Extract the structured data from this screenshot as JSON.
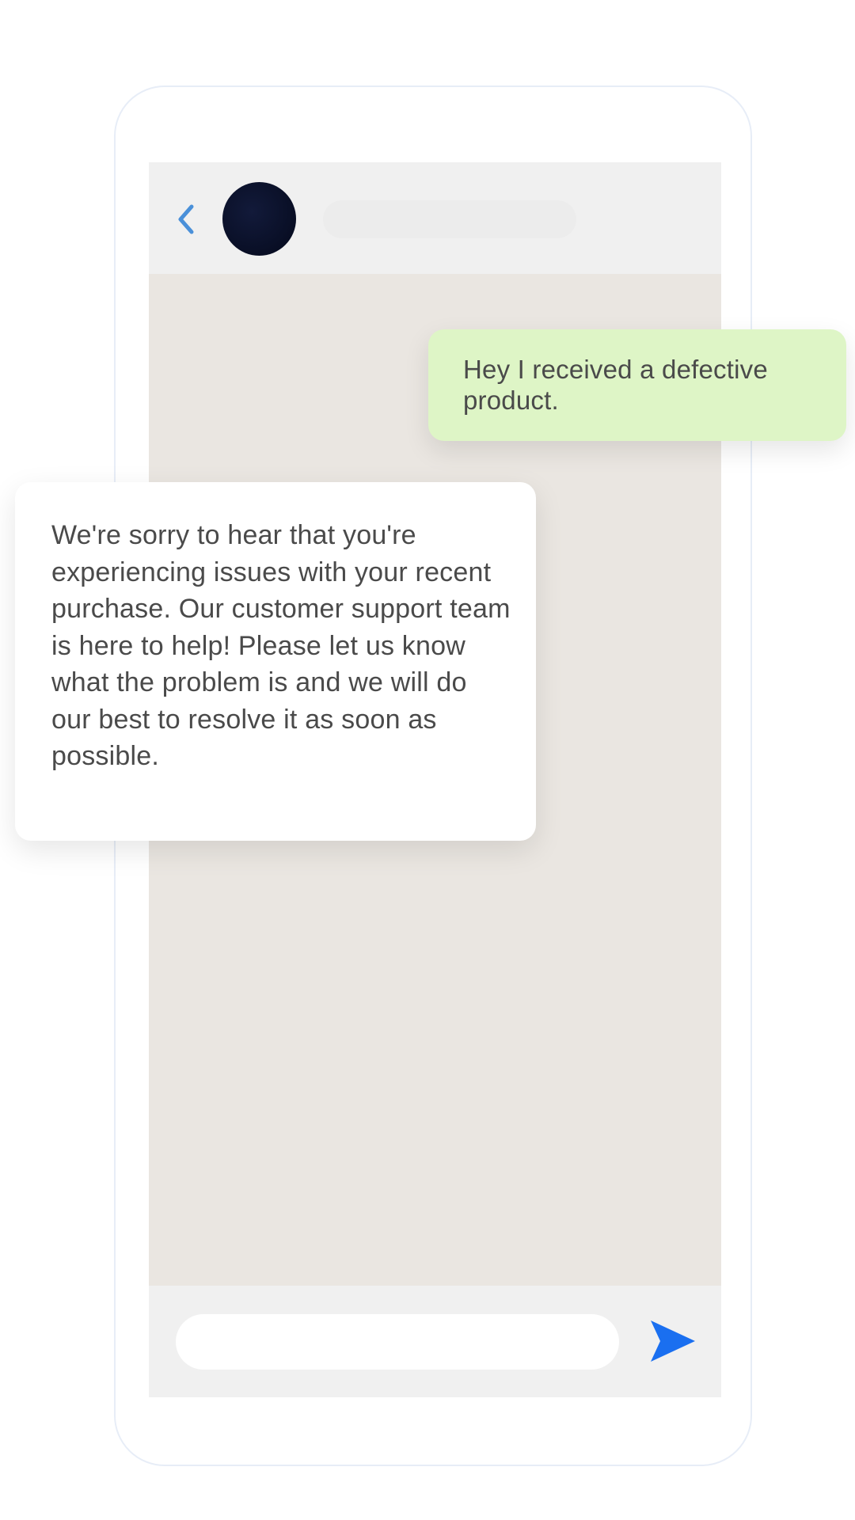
{
  "chat": {
    "header": {
      "back_icon": "chevron-left-icon",
      "avatar_icon": "contact-avatar"
    },
    "messages": [
      {
        "direction": "outgoing",
        "text": "Hey I received a defective product."
      },
      {
        "direction": "incoming",
        "text": "We're sorry to hear that you're experiencing issues with your recent purchase. Our customer support team is here to help! Please let us know what the problem is and we will do our best to resolve it as soon as possible."
      }
    ],
    "composer": {
      "input_value": "",
      "send_icon": "send-icon"
    }
  },
  "colors": {
    "accent": "#1a73e8",
    "back_chevron": "#4a90d9",
    "outgoing_bubble": "#def5c6",
    "incoming_bubble": "#ffffff",
    "chat_background": "#eae6e1",
    "header_background": "#f0f0f0"
  }
}
